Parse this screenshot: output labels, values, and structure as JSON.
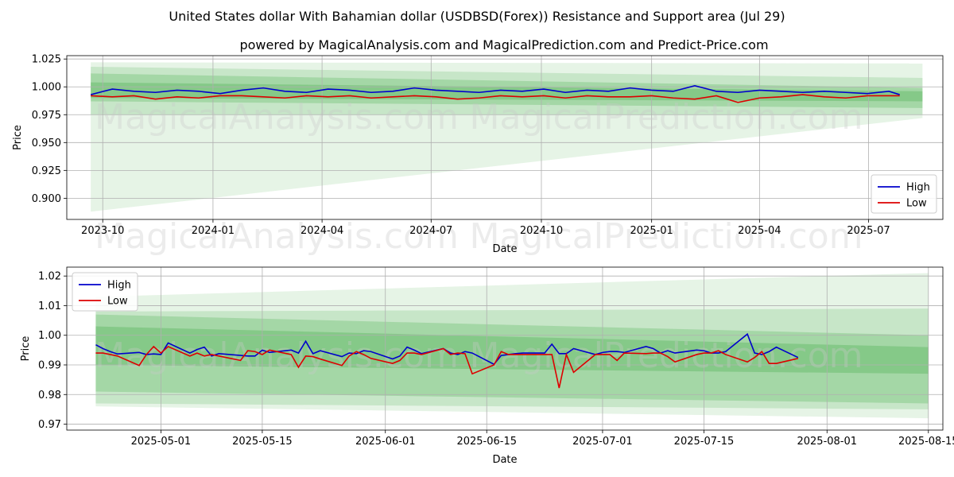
{
  "title": "United States dollar With Bahamian dollar (USDBSD(Forex)) Resistance and Support area (Jul 29)",
  "subtitle": "powered by MagicalAnalysis.com and MagicalPrediction.com and Predict-Price.com",
  "watermarks": [
    "MagicalAnalysis.com",
    "MagicalPrediction.com"
  ],
  "colors": {
    "high": "#0000cc",
    "low": "#dd0000",
    "band": "#4caf50"
  },
  "chart_data": [
    {
      "type": "line",
      "xlabel": "Date",
      "ylabel": "Price",
      "legend_position": "bottom-right",
      "grid": true,
      "xlim": [
        "2023-09-01",
        "2025-09-01"
      ],
      "ylim": [
        0.881,
        1.028
      ],
      "x_ticks": [
        "2023-10-01",
        "2024-01-01",
        "2024-04-01",
        "2024-07-01",
        "2024-10-01",
        "2025-01-01",
        "2025-04-01",
        "2025-07-01"
      ],
      "x_tick_labels": [
        "2023-10",
        "2024-01",
        "2024-04",
        "2024-07",
        "2024-10",
        "2025-01",
        "2025-04",
        "2025-07"
      ],
      "y_ticks": [
        0.9,
        0.925,
        0.95,
        0.975,
        1.0,
        1.025
      ],
      "y_tick_labels": [
        "0.900",
        "0.925",
        "0.950",
        "0.975",
        "1.000",
        "1.025"
      ],
      "bands": [
        {
          "start": "2023-09-21",
          "end": "2025-08-15",
          "upper": [
            1.022,
            1.021
          ],
          "lower": [
            0.888,
            0.972
          ],
          "opacity": 0.14
        },
        {
          "start": "2023-09-21",
          "end": "2025-08-15",
          "upper": [
            1.018,
            1.008
          ],
          "lower": [
            0.975,
            0.975
          ],
          "opacity": 0.2
        },
        {
          "start": "2023-09-21",
          "end": "2025-08-15",
          "upper": [
            1.012,
            0.999
          ],
          "lower": [
            0.987,
            0.981
          ],
          "opacity": 0.28
        },
        {
          "start": "2023-09-21",
          "end": "2025-08-15",
          "upper": [
            1.004,
            0.996
          ],
          "lower": [
            0.99,
            0.987
          ],
          "opacity": 0.35
        }
      ],
      "series": [
        {
          "name": "High",
          "color": "#0000cc",
          "x": [
            "2023-09-21",
            "2023-10-09",
            "2023-10-27",
            "2023-11-14",
            "2023-12-02",
            "2023-12-20",
            "2024-01-07",
            "2024-01-25",
            "2024-02-12",
            "2024-03-01",
            "2024-03-19",
            "2024-04-06",
            "2024-04-24",
            "2024-05-12",
            "2024-05-30",
            "2024-06-17",
            "2024-07-05",
            "2024-07-23",
            "2024-08-10",
            "2024-08-28",
            "2024-09-15",
            "2024-10-03",
            "2024-10-21",
            "2024-11-08",
            "2024-11-26",
            "2024-12-14",
            "2025-01-01",
            "2025-01-19",
            "2025-02-06",
            "2025-02-24",
            "2025-03-14",
            "2025-04-01",
            "2025-04-19",
            "2025-05-07",
            "2025-05-25",
            "2025-06-12",
            "2025-06-30",
            "2025-07-18",
            "2025-07-27"
          ],
          "values": [
            0.993,
            0.998,
            0.996,
            0.995,
            0.997,
            0.996,
            0.994,
            0.997,
            0.999,
            0.996,
            0.995,
            0.998,
            0.997,
            0.995,
            0.996,
            0.999,
            0.997,
            0.996,
            0.995,
            0.997,
            0.996,
            0.998,
            0.995,
            0.997,
            0.996,
            0.999,
            0.997,
            0.996,
            1.001,
            0.996,
            0.995,
            0.997,
            0.996,
            0.995,
            0.996,
            0.995,
            0.994,
            0.996,
            0.993
          ]
        },
        {
          "name": "Low",
          "color": "#dd0000",
          "x": [
            "2023-09-21",
            "2023-10-09",
            "2023-10-27",
            "2023-11-14",
            "2023-12-02",
            "2023-12-20",
            "2024-01-07",
            "2024-01-25",
            "2024-02-12",
            "2024-03-01",
            "2024-03-19",
            "2024-04-06",
            "2024-04-24",
            "2024-05-12",
            "2024-05-30",
            "2024-06-17",
            "2024-07-05",
            "2024-07-23",
            "2024-08-10",
            "2024-08-28",
            "2024-09-15",
            "2024-10-03",
            "2024-10-21",
            "2024-11-08",
            "2024-11-26",
            "2024-12-14",
            "2025-01-01",
            "2025-01-19",
            "2025-02-06",
            "2025-02-24",
            "2025-03-14",
            "2025-04-01",
            "2025-04-19",
            "2025-05-07",
            "2025-05-25",
            "2025-06-12",
            "2025-06-30",
            "2025-07-18",
            "2025-07-27"
          ],
          "values": [
            0.992,
            0.991,
            0.992,
            0.989,
            0.991,
            0.99,
            0.992,
            0.992,
            0.991,
            0.99,
            0.992,
            0.991,
            0.992,
            0.99,
            0.991,
            0.992,
            0.991,
            0.989,
            0.99,
            0.992,
            0.991,
            0.992,
            0.99,
            0.992,
            0.991,
            0.991,
            0.992,
            0.99,
            0.989,
            0.992,
            0.986,
            0.99,
            0.991,
            0.993,
            0.991,
            0.99,
            0.992,
            0.992,
            0.992
          ]
        }
      ]
    },
    {
      "type": "line",
      "xlabel": "Date",
      "ylabel": "Price",
      "legend_position": "top-left",
      "grid": true,
      "xlim": [
        "2025-04-18",
        "2025-08-17"
      ],
      "ylim": [
        0.968,
        1.023
      ],
      "x_ticks": [
        "2025-05-01",
        "2025-05-15",
        "2025-06-01",
        "2025-06-15",
        "2025-07-01",
        "2025-07-15",
        "2025-08-01",
        "2025-08-15"
      ],
      "x_tick_labels": [
        "2025-05-01",
        "2025-05-15",
        "2025-06-01",
        "2025-06-15",
        "2025-07-01",
        "2025-07-15",
        "2025-08-01",
        "2025-08-15"
      ],
      "y_ticks": [
        0.97,
        0.98,
        0.99,
        1.0,
        1.01,
        1.02
      ],
      "y_tick_labels": [
        "0.97",
        "0.98",
        "0.99",
        "1.00",
        "1.01",
        "1.02"
      ],
      "bands": [
        {
          "start": "2025-04-22",
          "end": "2025-08-15",
          "upper": [
            1.013,
            1.021
          ],
          "lower": [
            0.976,
            0.972
          ],
          "opacity": 0.14
        },
        {
          "start": "2025-04-22",
          "end": "2025-08-15",
          "upper": [
            1.008,
            1.009
          ],
          "lower": [
            0.977,
            0.975
          ],
          "opacity": 0.2
        },
        {
          "start": "2025-04-22",
          "end": "2025-08-15",
          "upper": [
            1.007,
            1.0
          ],
          "lower": [
            0.981,
            0.977
          ],
          "opacity": 0.28
        },
        {
          "start": "2025-04-22",
          "end": "2025-08-15",
          "upper": [
            1.003,
            0.996
          ],
          "lower": [
            0.99,
            0.987
          ],
          "opacity": 0.35
        }
      ],
      "series": [
        {
          "name": "High",
          "color": "#0000cc",
          "x": [
            "2025-04-22",
            "2025-04-23",
            "2025-04-24",
            "2025-04-25",
            "2025-04-28",
            "2025-04-29",
            "2025-04-30",
            "2025-05-01",
            "2025-05-02",
            "2025-05-05",
            "2025-05-06",
            "2025-05-07",
            "2025-05-08",
            "2025-05-09",
            "2025-05-12",
            "2025-05-13",
            "2025-05-14",
            "2025-05-15",
            "2025-05-16",
            "2025-05-19",
            "2025-05-20",
            "2025-05-21",
            "2025-05-22",
            "2025-05-23",
            "2025-05-26",
            "2025-05-27",
            "2025-05-28",
            "2025-05-29",
            "2025-05-30",
            "2025-06-02",
            "2025-06-03",
            "2025-06-04",
            "2025-06-05",
            "2025-06-06",
            "2025-06-09",
            "2025-06-10",
            "2025-06-11",
            "2025-06-12",
            "2025-06-13",
            "2025-06-16",
            "2025-06-17",
            "2025-06-18",
            "2025-06-19",
            "2025-06-20",
            "2025-06-23",
            "2025-06-24",
            "2025-06-25",
            "2025-06-26",
            "2025-06-27",
            "2025-06-30",
            "2025-07-01",
            "2025-07-02",
            "2025-07-03",
            "2025-07-04",
            "2025-07-07",
            "2025-07-08",
            "2025-07-09",
            "2025-07-10",
            "2025-07-11",
            "2025-07-14",
            "2025-07-15",
            "2025-07-16",
            "2025-07-17",
            "2025-07-18",
            "2025-07-21",
            "2025-07-22",
            "2025-07-23",
            "2025-07-24",
            "2025-07-25",
            "2025-07-28"
          ],
          "values": [
            0.9968,
            0.9955,
            0.9945,
            0.9937,
            0.9942,
            0.9935,
            0.9937,
            0.9935,
            0.9974,
            0.994,
            0.9952,
            0.996,
            0.993,
            0.9938,
            0.9932,
            0.993,
            0.993,
            0.995,
            0.9942,
            0.995,
            0.994,
            0.998,
            0.9938,
            0.9948,
            0.9928,
            0.994,
            0.9938,
            0.9948,
            0.9945,
            0.992,
            0.993,
            0.996,
            0.995,
            0.9938,
            0.9955,
            0.994,
            0.9935,
            0.9945,
            0.994,
            0.9902,
            0.9932,
            0.9935,
            0.9938,
            0.994,
            0.994,
            0.997,
            0.9938,
            0.9938,
            0.9955,
            0.9935,
            0.9942,
            0.9945,
            0.9945,
            0.9942,
            0.9962,
            0.9955,
            0.994,
            0.9948,
            0.994,
            0.995,
            0.9948,
            0.994,
            0.994,
            0.9945,
            1.0004,
            0.994,
            0.9935,
            0.9945,
            0.996,
            0.9925
          ],
          "vx": "index"
        },
        {
          "name": "Low",
          "color": "#dd0000",
          "x": [
            "2025-04-22",
            "2025-04-23",
            "2025-04-24",
            "2025-04-25",
            "2025-04-28",
            "2025-04-29",
            "2025-04-30",
            "2025-05-01",
            "2025-05-02",
            "2025-05-05",
            "2025-05-06",
            "2025-05-07",
            "2025-05-08",
            "2025-05-09",
            "2025-05-12",
            "2025-05-13",
            "2025-05-14",
            "2025-05-15",
            "2025-05-16",
            "2025-05-19",
            "2025-05-20",
            "2025-05-21",
            "2025-05-22",
            "2025-05-23",
            "2025-05-26",
            "2025-05-27",
            "2025-05-28",
            "2025-05-29",
            "2025-05-30",
            "2025-06-02",
            "2025-06-03",
            "2025-06-04",
            "2025-06-05",
            "2025-06-06",
            "2025-06-09",
            "2025-06-10",
            "2025-06-11",
            "2025-06-12",
            "2025-06-13",
            "2025-06-16",
            "2025-06-17",
            "2025-06-18",
            "2025-06-19",
            "2025-06-20",
            "2025-06-23",
            "2025-06-24",
            "2025-06-25",
            "2025-06-26",
            "2025-06-27",
            "2025-06-30",
            "2025-07-01",
            "2025-07-02",
            "2025-07-03",
            "2025-07-04",
            "2025-07-07",
            "2025-07-08",
            "2025-07-09",
            "2025-07-10",
            "2025-07-11",
            "2025-07-14",
            "2025-07-15",
            "2025-07-16",
            "2025-07-17",
            "2025-07-18",
            "2025-07-21",
            "2025-07-22",
            "2025-07-23",
            "2025-07-24",
            "2025-07-25",
            "2025-07-28"
          ],
          "values": [
            0.994,
            0.994,
            0.9935,
            0.993,
            0.9898,
            0.9935,
            0.9962,
            0.994,
            0.9962,
            0.993,
            0.994,
            0.993,
            0.9935,
            0.993,
            0.9915,
            0.9948,
            0.9945,
            0.9935,
            0.995,
            0.9935,
            0.9892,
            0.993,
            0.9928,
            0.992,
            0.9898,
            0.993,
            0.9945,
            0.9935,
            0.9922,
            0.9905,
            0.9915,
            0.994,
            0.994,
            0.9935,
            0.9955,
            0.9935,
            0.994,
            0.9938,
            0.987,
            0.99,
            0.9945,
            0.9935,
            0.9935,
            0.9935,
            0.9935,
            0.9935,
            0.9822,
            0.9935,
            0.9875,
            0.9935,
            0.9935,
            0.9935,
            0.9915,
            0.994,
            0.9938,
            0.994,
            0.994,
            0.9928,
            0.991,
            0.9935,
            0.994,
            0.994,
            0.9948,
            0.9935,
            0.991,
            0.9925,
            0.9945,
            0.9905,
            0.9905,
            0.9922
          ],
          "vx": "index"
        }
      ]
    }
  ]
}
